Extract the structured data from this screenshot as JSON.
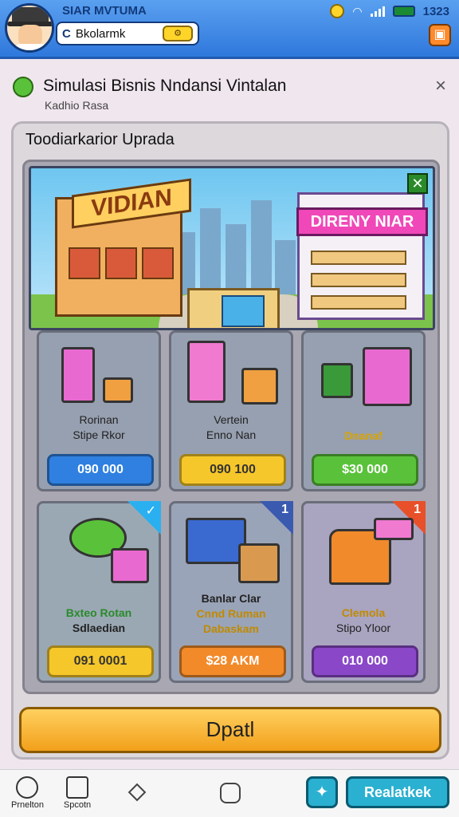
{
  "header": {
    "app_title": "SIAR MVTUMA",
    "search_value": "Bkolarmk",
    "search_prefix": "C",
    "clock": "1323",
    "wifi_icon": "wifi-icon",
    "gift_glyph": "▣"
  },
  "panel": {
    "title": "Simulasi Bisnis Nndansi Vintalan",
    "subtitle": "Kadhio Rasa",
    "close": "×"
  },
  "section": {
    "title": "Toodiarkarior Uprada"
  },
  "scene": {
    "left_shop_sign": "VIDIAN",
    "right_shop_sign": "DIRENY NIAR",
    "check": "✕"
  },
  "tiles": [
    {
      "name_lines": [
        "Rorinan",
        "Stipe Rkor"
      ],
      "price": "090 000",
      "button_color": "#2f80e0",
      "name_color": "#222222"
    },
    {
      "name_lines": [
        "Vertein",
        "Enno Nan"
      ],
      "price": "090 100",
      "button_color": "#f6c72a",
      "name_color": "#222222"
    },
    {
      "name_lines": [
        "Dnanaf"
      ],
      "price": "$30 000",
      "button_color": "#5ac23a",
      "name_color": "#d9a400"
    },
    {
      "name_lines": [
        "Bxteo Rotan",
        "Sdlaedian"
      ],
      "price": "091 0001",
      "button_color": "#f6c72a",
      "name_color": "#2a8a2a",
      "badge": "✓",
      "badge_color": "#2ab0f0"
    },
    {
      "name_lines": [
        "Banlar Clar",
        "Cnnd Ruman",
        "Dabaskam"
      ],
      "price": "$28 AKM",
      "button_color": "#f28a2a",
      "name_color": "#c08a00",
      "badge": "1",
      "badge_color": "#3a5ab0"
    },
    {
      "name_lines": [
        "Clemola",
        "Stipo Yloor"
      ],
      "price": "010 000",
      "button_color": "#8a48c8",
      "name_color": "#c08a00",
      "badge": "1",
      "badge_color": "#e8502a"
    }
  ],
  "main_button": "Dpatl",
  "bottom_nav": {
    "item1": "Prnelton",
    "item2": "Spcotn",
    "tool_glyph": "✦",
    "restart": "Realatkek"
  }
}
